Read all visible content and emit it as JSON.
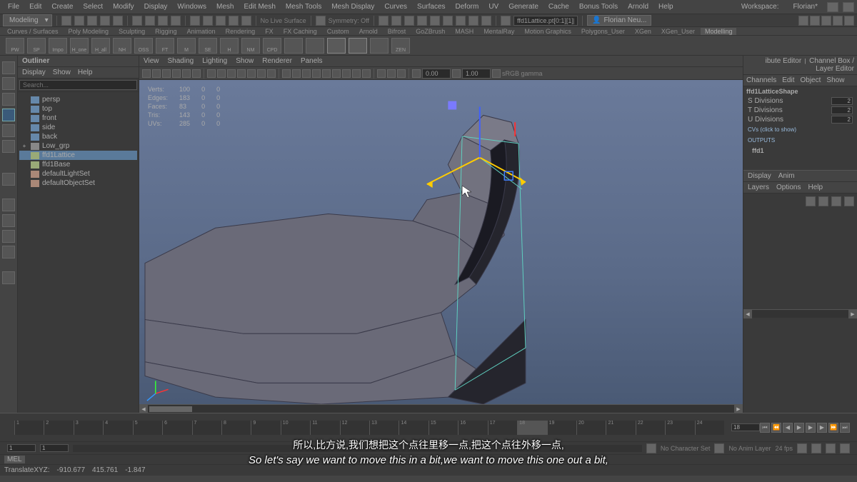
{
  "menu": [
    "File",
    "Edit",
    "Create",
    "Select",
    "Modify",
    "Display",
    "Windows",
    "Mesh",
    "Edit Mesh",
    "Mesh Tools",
    "Mesh Display",
    "Curves",
    "Surfaces",
    "Deform",
    "UV",
    "Generate",
    "Cache",
    "Bonus Tools",
    "Arnold",
    "Help"
  ],
  "workspace": {
    "label": "Workspace:",
    "value": "Florian*"
  },
  "mode": "Modeling",
  "status_field": "ffd1Lattice.pt[0:1][1][1]",
  "user": "Florian Neu...",
  "symmetry": "Symmetry: Off",
  "live_surface": "No Live Surface",
  "shelves": [
    "Curves / Surfaces",
    "Poly Modeling",
    "Sculpting",
    "Rigging",
    "Animation",
    "Rendering",
    "FX",
    "FX Caching",
    "Custom",
    "Arnold",
    "Bifrost",
    "GoZBrush",
    "MASH",
    "MentalRay",
    "Motion Graphics",
    "Polygons_User",
    "XGen",
    "XGen_User",
    "Modelling"
  ],
  "shelf_btns": [
    "PW",
    "SP",
    "Impo",
    "H_one",
    "H_all",
    "NH",
    "OSS",
    "FT",
    "M",
    "SE",
    "H",
    "NM",
    "CPD",
    "",
    "",
    "",
    "",
    "",
    "ZEN"
  ],
  "outliner": {
    "title": "Outliner",
    "menu": [
      "Display",
      "Show",
      "Help"
    ],
    "search_placeholder": "Search...",
    "items": [
      {
        "icon": "cam",
        "label": "persp",
        "indent": 1
      },
      {
        "icon": "cam",
        "label": "top",
        "indent": 1
      },
      {
        "icon": "cam",
        "label": "front",
        "indent": 1
      },
      {
        "icon": "cam",
        "label": "side",
        "indent": 1
      },
      {
        "icon": "cam",
        "label": "back",
        "indent": 1
      },
      {
        "icon": "grp",
        "label": "Low_grp",
        "indent": 0,
        "exp": "+"
      },
      {
        "icon": "lat",
        "label": "ffd1Lattice",
        "indent": 1,
        "sel": true
      },
      {
        "icon": "lat",
        "label": "ffd1Base",
        "indent": 1
      },
      {
        "icon": "set",
        "label": "defaultLightSet",
        "indent": 1
      },
      {
        "icon": "set",
        "label": "defaultObjectSet",
        "indent": 1
      }
    ]
  },
  "viewport_menu": [
    "View",
    "Shading",
    "Lighting",
    "Show",
    "Renderer",
    "Panels"
  ],
  "viewport_fields": {
    "a": "0.00",
    "b": "1.00",
    "gamma": "sRGB gamma"
  },
  "stats": {
    "rows": [
      {
        "name": "Verts:",
        "a": "100",
        "b": "0",
        "c": "0"
      },
      {
        "name": "Edges:",
        "a": "183",
        "b": "0",
        "c": "0"
      },
      {
        "name": "Faces:",
        "a": "83",
        "b": "0",
        "c": "0"
      },
      {
        "name": "Tris:",
        "a": "143",
        "b": "0",
        "c": "0"
      },
      {
        "name": "UVs:",
        "a": "285",
        "b": "0",
        "c": "0"
      }
    ]
  },
  "right": {
    "tabs": [
      "ibute Editor",
      "Channel Box / Layer Editor"
    ],
    "menu": [
      "Channels",
      "Edit",
      "Object",
      "Show"
    ],
    "shape": "ffd1LatticeShape",
    "attrs": [
      {
        "label": "S Divisions",
        "value": "2"
      },
      {
        "label": "T Divisions",
        "value": "2"
      },
      {
        "label": "U Divisions",
        "value": "2"
      }
    ],
    "cvs": "CVs (click to show)",
    "outputs": "OUTPUTS",
    "output_item": "ffd1",
    "display_tabs": [
      "Display",
      "Anim"
    ],
    "layer_menu": [
      "Layers",
      "Options",
      "Help"
    ]
  },
  "timeline": {
    "ticks": [
      "1",
      "2",
      "3",
      "4",
      "5",
      "6",
      "7",
      "8",
      "9",
      "10",
      "11",
      "12",
      "13",
      "14",
      "15",
      "16",
      "17",
      "18",
      "19",
      "20",
      "21",
      "22",
      "23",
      "24"
    ],
    "current": "18",
    "frame_box": "18",
    "range_start": "1",
    "range_end": "1",
    "char_set": "No Character Set",
    "anim_layer": "No Anim Layer",
    "fps": "24 fps"
  },
  "cmdline": {
    "label": "MEL"
  },
  "helpline": {
    "prefix": "TranslateXYZ:",
    "x": "-910.677",
    "y": "415.761",
    "z": "-1.847"
  },
  "subtitles": {
    "cn": "所以,比方说,我们想把这个点往里移一点,把这个点往外移一点,",
    "en": "So let's say we want to move this in a bit,we want to move this one out a bit,"
  }
}
